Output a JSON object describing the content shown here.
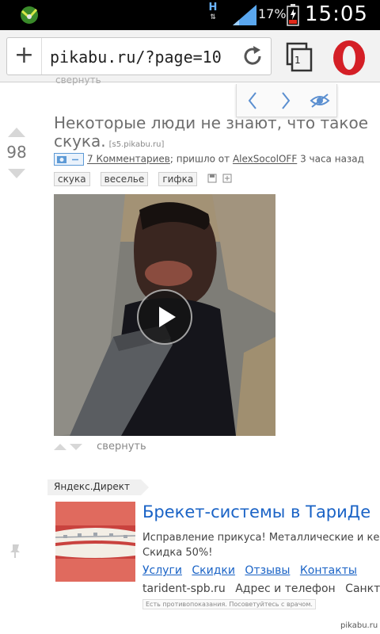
{
  "status": {
    "network": "H",
    "battery": "17%",
    "time": "15:05"
  },
  "browser": {
    "url": "pikabu.ru/?page=10",
    "tabs_count": "1"
  },
  "collapsed_prev": "свернуть",
  "post": {
    "score": "98",
    "title": "Некоторые люди не знают, что такое скука.",
    "source": "[s5.pikabu.ru]",
    "comments": "7 Комментариев",
    "sent_from": "; пришло от ",
    "author": "AlexSocolOFF",
    "time_ago": " 3 часа назад",
    "tags": [
      "скука",
      "веселье",
      "гифка"
    ],
    "collapse": "свернуть"
  },
  "ad": {
    "label": "Яндекс.Директ",
    "title": "Брекет-системы в ТариДе",
    "line1": "Исправление прикуса! Металлические и кер",
    "line2": "Скидка 50%!",
    "links": [
      "Услуги",
      "Скидки",
      "Отзывы",
      "Контакты"
    ],
    "domain": "tarident-spb.ru",
    "contacts": "Адрес и телефон",
    "city": "Санкт-П",
    "warning": "Есть противопоказания. Посоветуйтесь с врачом."
  },
  "watermark": "pikabu.ru",
  "colors": {
    "link": "#1a63c6",
    "opera_red": "#d41f26"
  }
}
